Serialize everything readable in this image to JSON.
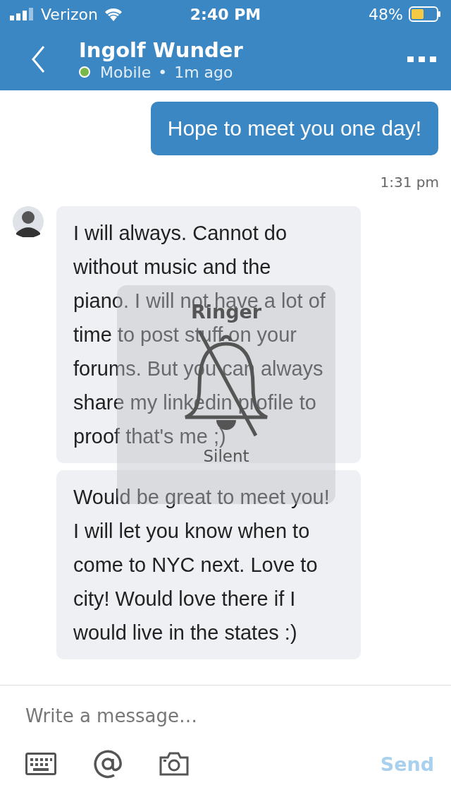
{
  "status_bar": {
    "carrier": "Verizon",
    "time": "2:40 PM",
    "battery": "48%"
  },
  "header": {
    "name": "Ingolf Wunder",
    "online": true,
    "device": "Mobile",
    "separator": "•",
    "last_seen": "1m ago"
  },
  "messages": [
    {
      "kind": "outgoing",
      "text": "Hope to meet you one day!",
      "time": "1:31 pm"
    },
    {
      "kind": "incoming",
      "show_avatar": true,
      "text": "I will always. Cannot do without music and the piano. I will not have a lot of time to post stuff on your forums. But you can always share my linkedin profile to proof that's me ;)"
    },
    {
      "kind": "incoming",
      "show_avatar": false,
      "text": "Would be great to meet you! I will let you know when to come to NYC next. Love to city! Would love there if I would live in the states :)"
    }
  ],
  "ringer": {
    "title": "Ringer",
    "silent": true,
    "mode": "Silent"
  },
  "composer": {
    "placeholder": "Write a message…",
    "send": "Send",
    "send_disabled": true
  }
}
